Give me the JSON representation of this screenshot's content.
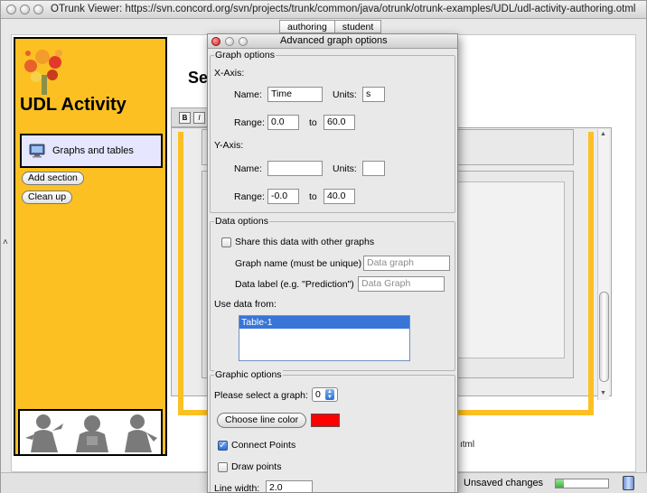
{
  "window": {
    "title": "OTrunk Viewer: https://svn.concord.org/svn/projects/trunk/common/java/otrunk/otrunk-examples/UDL/udl-activity-authoring.otml"
  },
  "tabs": [
    {
      "label": "authoring"
    },
    {
      "label": "student"
    }
  ],
  "sidebar": {
    "activity_title": "UDL Activity",
    "items": [
      {
        "label": "Graphs and tables",
        "icon": "computer-monitor-icon"
      }
    ],
    "add_section_label": "Add section",
    "clean_up_label": "Clean up",
    "brand_color": "#fcc023"
  },
  "content": {
    "section_heading": "Se",
    "format_buttons": [
      {
        "label": "B"
      },
      {
        "label": "I"
      }
    ],
    "file_label": "ıtml"
  },
  "status_bar": {
    "text": "Unsaved changes",
    "progress": 0.15
  },
  "dialog": {
    "title": "Advanced graph options",
    "graph_options": {
      "legend": "Graph options",
      "x_axis": {
        "heading": "X-Axis:",
        "name_label": "Name:",
        "name_value": "Time",
        "units_label": "Units:",
        "units_value": "s",
        "range_label": "Range:",
        "range_min": "0.0",
        "to_label": "to",
        "range_max": "60.0"
      },
      "y_axis": {
        "heading": "Y-Axis:",
        "name_label": "Name:",
        "name_value": "",
        "units_label": "Units:",
        "units_value": "",
        "range_label": "Range:",
        "range_min": "-0.0",
        "to_label": "to",
        "range_max": "40.0"
      }
    },
    "data_options": {
      "legend": "Data options",
      "share_label": "Share this data with other graphs",
      "share_checked": false,
      "graph_name_label": "Graph name (must be unique)",
      "graph_name_placeholder": "Data graph",
      "data_label_label": "Data label (e.g. \"Prediction\")",
      "data_label_placeholder": "Data Graph",
      "use_data_from_label": "Use data from:",
      "sources": [
        {
          "label": "Table-1",
          "selected": true
        }
      ]
    },
    "graphic_options": {
      "legend": "Graphic options",
      "select_graph_label": "Please select a graph:",
      "selected_graph": "0",
      "choose_color_label": "Choose line color",
      "line_color": "#ff0000",
      "connect_points_label": "Connect Points",
      "connect_points_checked": true,
      "draw_points_label": "Draw points",
      "draw_points_checked": false,
      "line_width_label": "Line width:",
      "line_width_value": "2.0"
    }
  }
}
